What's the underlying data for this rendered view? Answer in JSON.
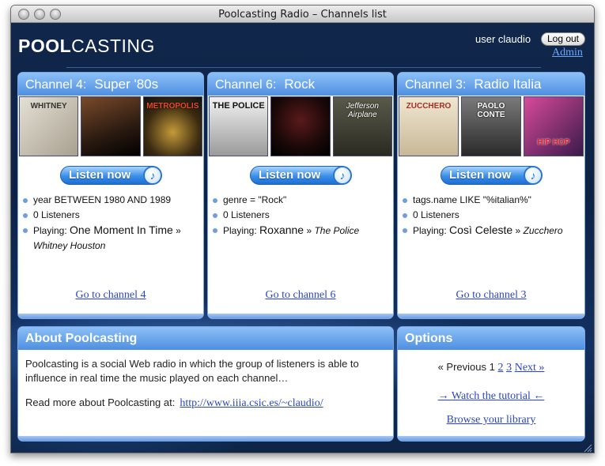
{
  "window": {
    "title": "Poolcasting Radio – Channels list"
  },
  "header": {
    "logo_bold": "POOL",
    "logo_rest": "CASTING",
    "user_label": "user claudio",
    "logout_label": "Log out",
    "admin_label": "Admin"
  },
  "channels": [
    {
      "number_label": "Channel 4:",
      "name": "Super '80s",
      "covers": [
        {
          "text": "WHITNEY",
          "bg": "#c9c4b6"
        },
        {
          "text": "",
          "bg": "#3a2a1c"
        },
        {
          "text": "METROPOLIS",
          "bg": "#1c1712"
        }
      ],
      "listen_label": "Listen now",
      "rule": "year BETWEEN 1980 AND 1989",
      "listeners": "0 Listeners",
      "playing_label": "Playing:",
      "song": "One Moment In Time",
      "separator": "»",
      "artist": "Whitney Houston",
      "goto_label": "Go to channel 4"
    },
    {
      "number_label": "Channel 6:",
      "name": "Rock",
      "covers": [
        {
          "text": "THE POLICE",
          "bg": "#d8d8d8"
        },
        {
          "text": "",
          "bg": "#140c0c"
        },
        {
          "text": "Jefferson Airplane",
          "bg": "#3a3a32"
        }
      ],
      "listen_label": "Listen now",
      "rule": "genre = \"Rock\"",
      "listeners": "0 Listeners",
      "playing_label": "Playing:",
      "song": "Roxanne",
      "separator": "»",
      "artist": "The Police",
      "goto_label": "Go to channel 6"
    },
    {
      "number_label": "Channel 3:",
      "name": "Radio Italia",
      "covers": [
        {
          "text": "ZUCCHERO",
          "bg": "#e8dcc8"
        },
        {
          "text": "PAOLO CONTE",
          "bg": "#5a5a5a"
        },
        {
          "text": "HIP HOP",
          "bg": "#3a1a3c"
        }
      ],
      "listen_label": "Listen now",
      "rule": "tags.name LIKE \"%italian%\"",
      "listeners": "0 Listeners",
      "playing_label": "Playing:",
      "song": "Così Celeste",
      "separator": "»",
      "artist": "Zucchero",
      "goto_label": "Go to channel 3"
    }
  ],
  "about": {
    "title": "About Poolcasting",
    "text": "Poolcasting is a social Web radio in which the group of listeners is able to influence in real time the music played on each channel…",
    "more_label": "Read more about Poolcasting at:",
    "more_link": "http://www.iiia.csic.es/~claudio/"
  },
  "options": {
    "title": "Options",
    "previous_label": "« Previous",
    "current_page": "1",
    "page_2": "2",
    "page_3": "3",
    "next_label": "Next »",
    "tutorial_label": "→ Watch the tutorial ←",
    "library_label": "Browse your library"
  }
}
